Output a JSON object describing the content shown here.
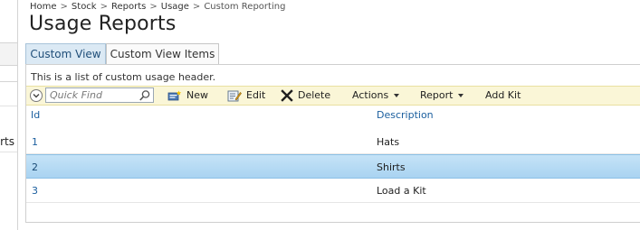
{
  "breadcrumb": [
    "Home",
    "Stock",
    "Reports",
    "Usage",
    "Custom Reporting"
  ],
  "page_title": "Usage Reports",
  "tabs": [
    {
      "label": "Custom View",
      "active": true
    },
    {
      "label": "Custom View Items",
      "active": false
    }
  ],
  "sidebar": {
    "partial_text": "rts"
  },
  "list": {
    "header_text": "This is a list of custom usage header.",
    "columns": [
      "Id",
      "Description"
    ],
    "rows": [
      {
        "id": "1",
        "description": "Hats",
        "selected": false
      },
      {
        "id": "2",
        "description": "Shirts",
        "selected": true
      },
      {
        "id": "3",
        "description": "Load a Kit",
        "selected": false
      }
    ]
  },
  "toolbar": {
    "quick_find_placeholder": "Quick Find",
    "new_label": "New",
    "edit_label": "Edit",
    "delete_label": "Delete",
    "actions_label": "Actions",
    "report_label": "Report",
    "add_kit_label": "Add Kit"
  },
  "colors": {
    "toolbar_bg": "#faf6d7",
    "selected_row": "#b8dbf3",
    "active_tab": "#dbe9f4",
    "link_blue": "#1a5e9e"
  }
}
